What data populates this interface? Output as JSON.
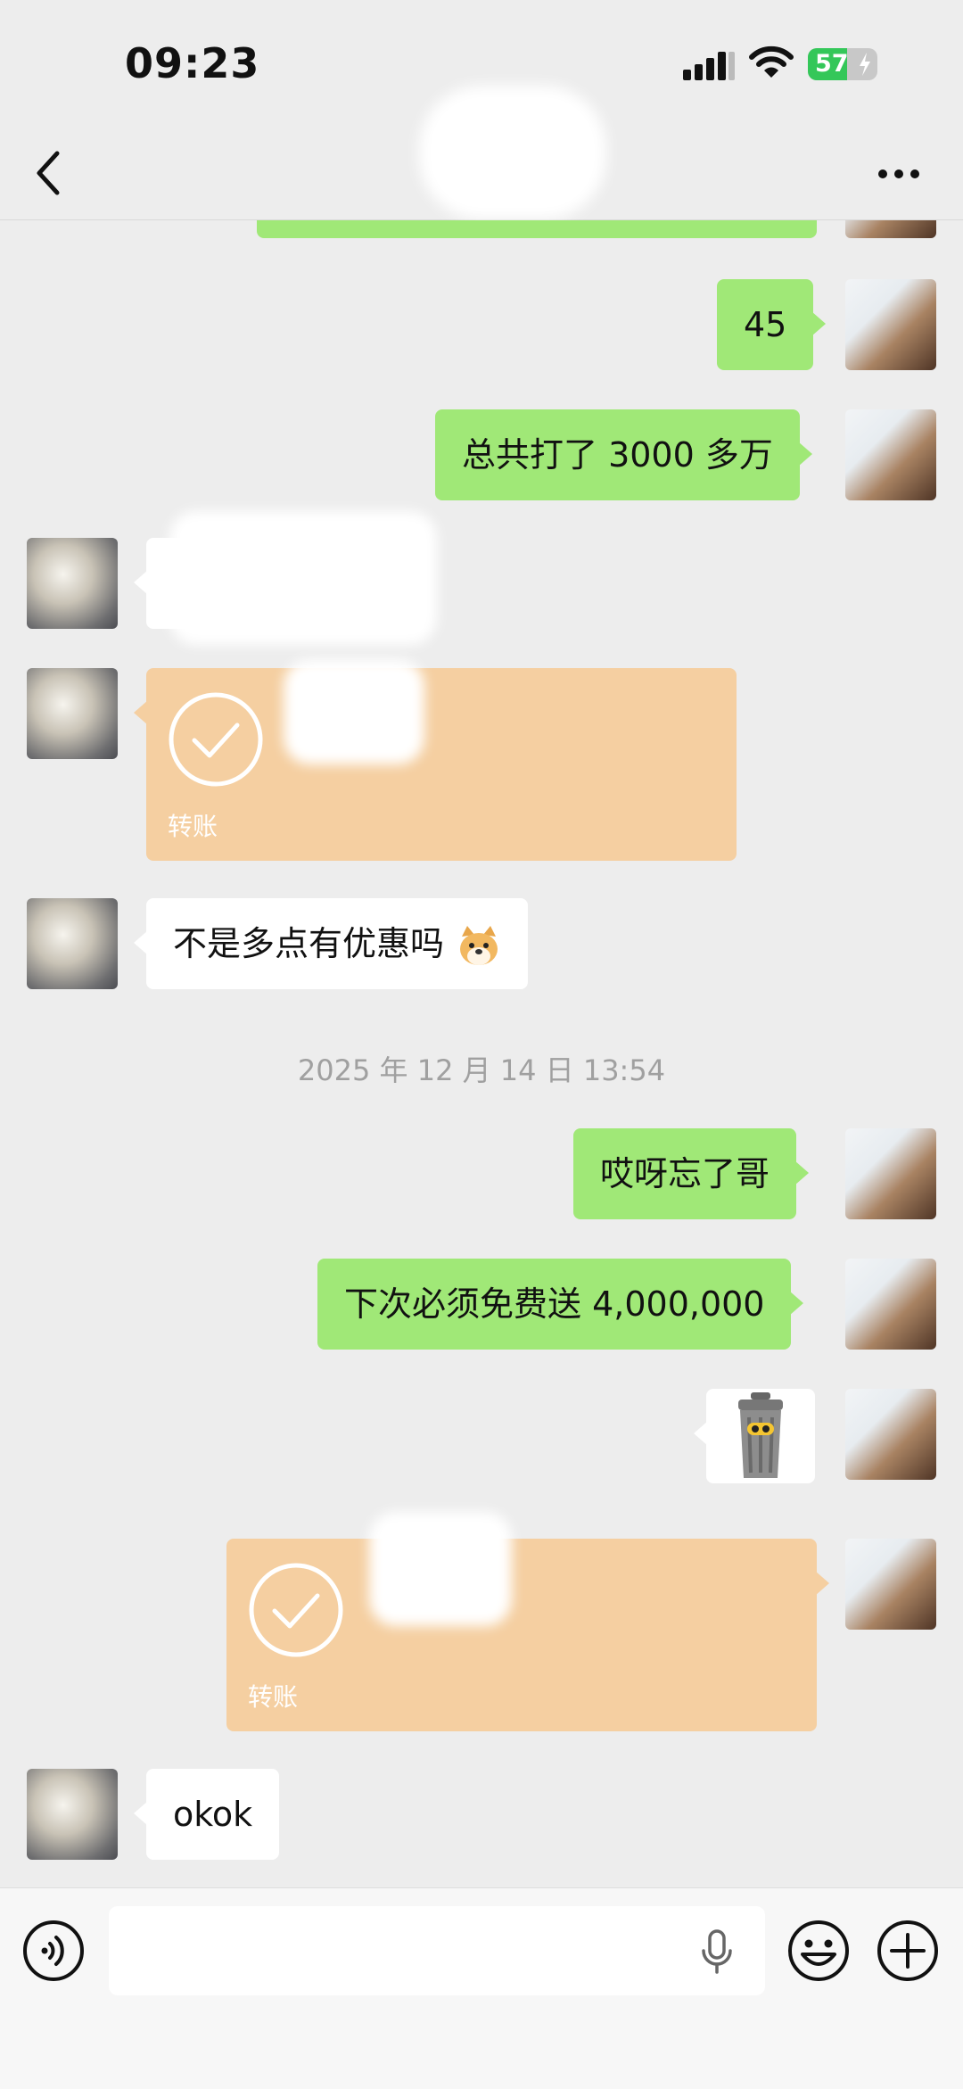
{
  "status_bar": {
    "time": "09:23",
    "battery_level": "57",
    "battery_percent": 57
  },
  "nav": {
    "back_icon": "chevron-left-icon",
    "more_icon": "more-dots-icon"
  },
  "messages": {
    "m45": "45",
    "m3000": "总共打了 3000 多万",
    "transfer_label_1": "转账",
    "m_discount": "不是多点有优惠吗",
    "timestamp": "2025 年 12 月 14 日 13:54",
    "m_forgot": "哎呀忘了哥",
    "m_free": "下次必须免费送 4,000,000",
    "transfer_label_2": "转账",
    "m_okok": "okok"
  },
  "input_bar": {
    "voice_icon": "voice-icon",
    "mic_icon": "microphone-icon",
    "emoji_icon": "emoji-icon",
    "plus_icon": "plus-icon"
  },
  "colors": {
    "bubble_green": "#a0e877",
    "transfer": "#f5cfa1",
    "background": "#ededed"
  }
}
